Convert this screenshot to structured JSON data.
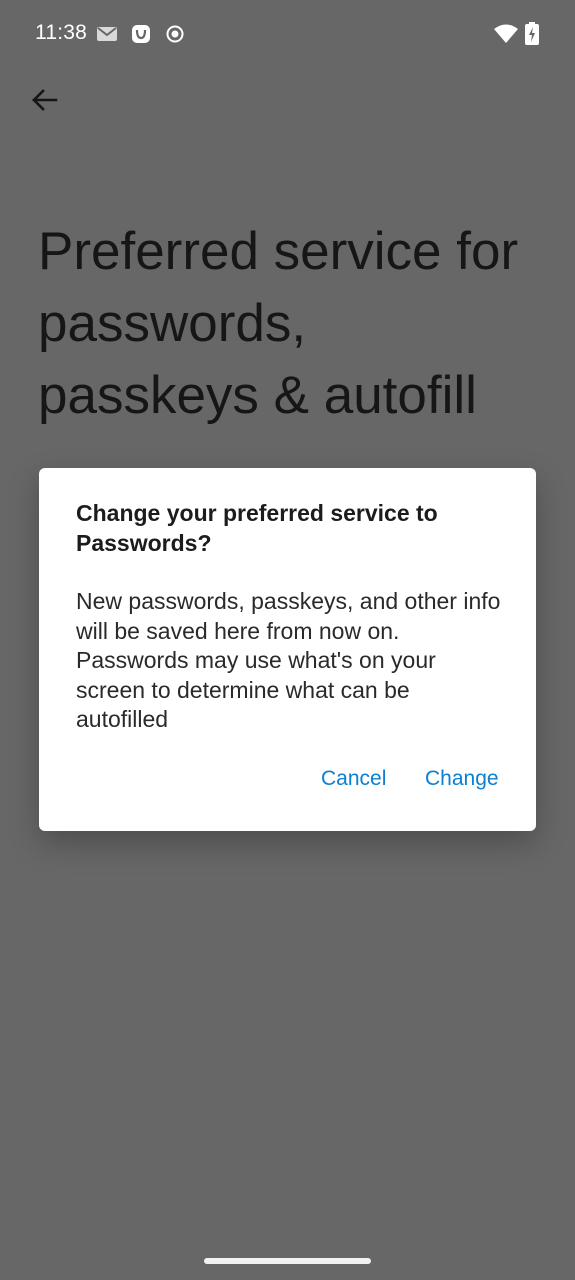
{
  "status_bar": {
    "time": "11:38",
    "icons": [
      "mail-icon",
      "app-notification-icon",
      "record-icon",
      "wifi-icon",
      "battery-charging-icon"
    ]
  },
  "header": {
    "back_icon": "arrow-back-icon",
    "title": "Preferred service for passwords, passkeys & autofill"
  },
  "dialog": {
    "title": "Change your preferred service to Passwords?",
    "body": "New passwords, passkeys, and other info will be saved here from now on. Passwords may use what's on your screen to determine what can be autofilled",
    "cancel_label": "Cancel",
    "confirm_label": "Change"
  },
  "colors": {
    "scrim_background": "#676767",
    "dialog_background": "#ffffff",
    "accent": "#0b7fd4"
  }
}
